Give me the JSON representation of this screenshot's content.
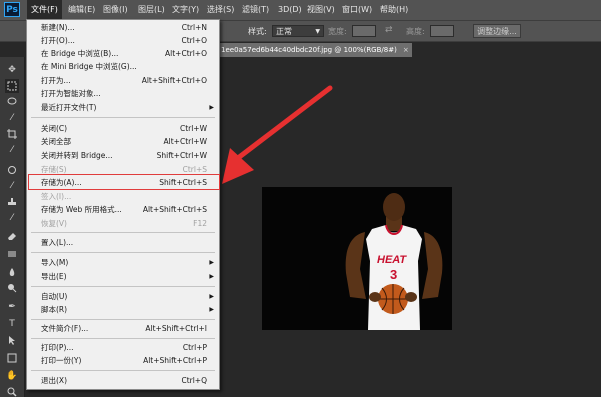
{
  "app": {
    "logo": "Ps"
  },
  "menubar": {
    "items": [
      "文件(F)",
      "编辑(E)",
      "图像(I)",
      "图层(L)",
      "文字(Y)",
      "选择(S)",
      "滤镜(T)",
      "3D(D)",
      "视图(V)",
      "窗口(W)",
      "帮助(H)"
    ]
  },
  "options": {
    "style_label": "样式:",
    "style_value": "正常",
    "width_label": "宽度:",
    "height_label": "高度:",
    "refine_edge": "调整边缘..."
  },
  "document": {
    "tab_title": "1ee0a57ed6b44c40dbdc20f.jpg @ 100%(RGB/8#)",
    "close": "×"
  },
  "file_menu": {
    "new": {
      "label": "新建(N)...",
      "shortcut": "Ctrl+N"
    },
    "open": {
      "label": "打开(O)...",
      "shortcut": "Ctrl+O"
    },
    "browse_bridge": {
      "label": "在 Bridge 中浏览(B)...",
      "shortcut": "Alt+Ctrl+O"
    },
    "browse_mini_bridge": {
      "label": "在 Mini Bridge 中浏览(G)..."
    },
    "open_as": {
      "label": "打开为...",
      "shortcut": "Alt+Shift+Ctrl+O"
    },
    "open_smart": {
      "label": "打开为智能对象..."
    },
    "recent": {
      "label": "最近打开文件(T)"
    },
    "close": {
      "label": "关闭(C)",
      "shortcut": "Ctrl+W"
    },
    "close_all": {
      "label": "关闭全部",
      "shortcut": "Alt+Ctrl+W"
    },
    "close_to_bridge": {
      "label": "关闭并转到 Bridge...",
      "shortcut": "Shift+Ctrl+W"
    },
    "save": {
      "label": "存储(S)",
      "shortcut": "Ctrl+S"
    },
    "save_as": {
      "label": "存储为(A)...",
      "shortcut": "Shift+Ctrl+S"
    },
    "check_in": {
      "label": "签入(I)..."
    },
    "save_for_web": {
      "label": "存储为 Web 所用格式...",
      "shortcut": "Alt+Shift+Ctrl+S"
    },
    "revert": {
      "label": "恢复(V)",
      "shortcut": "F12"
    },
    "place": {
      "label": "置入(L)..."
    },
    "import": {
      "label": "导入(M)"
    },
    "export": {
      "label": "导出(E)"
    },
    "automate": {
      "label": "自动(U)"
    },
    "scripts": {
      "label": "脚本(R)"
    },
    "file_info": {
      "label": "文件简介(F)...",
      "shortcut": "Alt+Shift+Ctrl+I"
    },
    "print": {
      "label": "打印(P)...",
      "shortcut": "Ctrl+P"
    },
    "print_one": {
      "label": "打印一份(Y)",
      "shortcut": "Alt+Shift+Ctrl+P"
    },
    "exit": {
      "label": "退出(X)",
      "shortcut": "Ctrl+Q"
    }
  },
  "colors": {
    "highlight": "#e03c3c",
    "arrow": "#e63030",
    "ps_blue": "#2fa4f4",
    "jersey_red": "#c8102e"
  },
  "photo": {
    "jersey_text": "HEAT",
    "jersey_number": "3"
  },
  "tools": [
    "move-icon",
    "marquee-icon",
    "lasso-icon",
    "quick-select-icon",
    "crop-icon",
    "eyedropper-icon",
    "healing-icon",
    "brush-icon",
    "stamp-icon",
    "history-brush-icon",
    "eraser-icon",
    "gradient-icon",
    "blur-icon",
    "dodge-icon",
    "pen-icon",
    "type-icon",
    "path-select-icon",
    "shape-icon",
    "hand-icon",
    "zoom-icon"
  ]
}
